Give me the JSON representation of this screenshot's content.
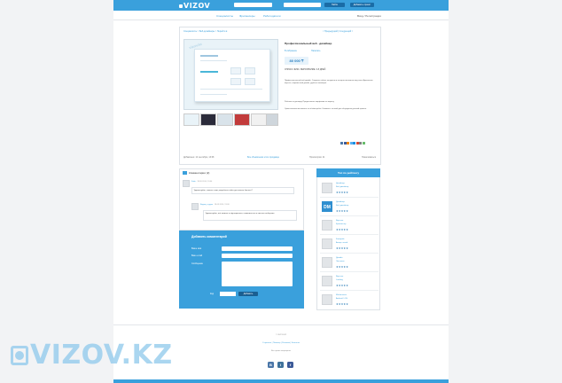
{
  "header": {
    "logo": "VIZOV",
    "search_button": "Найти",
    "post_button": "Добавить проект"
  },
  "nav": {
    "items": [
      "Специалисты",
      "Фрилансеры",
      "Работодатели"
    ],
    "login": "Вход / Регистрация"
  },
  "project": {
    "breadcrumb": "Специалисты > Веб-дизайнеры > Перейти в",
    "next_prev": "< Предыдущий | Следующий >",
    "title": "Профессиональный веб - дизайнер",
    "fav": "В избранное",
    "contact": "Написать",
    "price": "80 000 ₸",
    "specs": "ОПЛАТА: ФИКС.    ВЫПОЛНЕНИЕ: 3-5 ДНЕЙ",
    "desc1": "Профессиональный веб-дизайн. Создание сайтов, лендингов и интернет-магазинов под ключ. Адаптивная вёрстка, современный дизайн, удобная навигация.",
    "desc2": "Работаю по договору. Предоставляю портфолио по запросу.",
    "desc3": "Сроки выполнения зависят от объёма работ. Свяжитесь со мной для обсуждения деталей проекта.",
    "stats_left": "Добавлено: 14 сентября, 13:08",
    "stats_link": "Все объявления этого продавца",
    "stats_views": "Просмотров: 21",
    "stats_right": "Пожаловаться"
  },
  "comments": {
    "header": "Комментарии",
    "count": "(2)",
    "c1_author": "Кайя",
    "c1_date": "18.09.2014, 13:04",
    "c1_text": "Здравствуйте, сколько стоит разработка сайта для малого бизнеса?",
    "c2_author": "Вадим_студия",
    "c2_date": "18.09.2014, 13:30",
    "c2_text": "Здравствуйте, всё зависит от функционала, напишите мне в личные сообщения."
  },
  "form": {
    "title": "Добавить комментарий",
    "name_label": "Ваше имя",
    "email_label": "Ваш e-mail",
    "msg_label": "Сообщение",
    "captcha_label": "Код",
    "submit": "Добавить"
  },
  "sidebar": {
    "title": "Топ по рейтингу",
    "stars": "★★★★★",
    "items": [
      {
        "role": "Дизайнер",
        "name": "Веб-дизайнер",
        "initials": ""
      },
      {
        "role": "Дизайнер",
        "name": "Веб-дизайнер",
        "initials": "DM"
      },
      {
        "role": "Верстка",
        "name": "Фрилансер",
        "initials": ""
      },
      {
        "role": "Копирайт",
        "name": "Автор статей",
        "initials": ""
      },
      {
        "role": "Дизайн",
        "name": "Логотипы",
        "initials": ""
      },
      {
        "role": "Верстка",
        "name": "Landing",
        "initials": ""
      },
      {
        "role": "Мобильные",
        "name": "Android / iOS",
        "initials": ""
      }
    ]
  },
  "footer": {
    "copyright": "© VIZOV.KZ",
    "links": "О проекте | Помощь | Реклама | Контакты",
    "small": "Все права защищены",
    "social": [
      "В",
      "I",
      "f"
    ]
  },
  "watermark": "VIZOV.KZ",
  "colors": {
    "accent": "#3aa0dc",
    "dark": "#1a6ca6"
  }
}
